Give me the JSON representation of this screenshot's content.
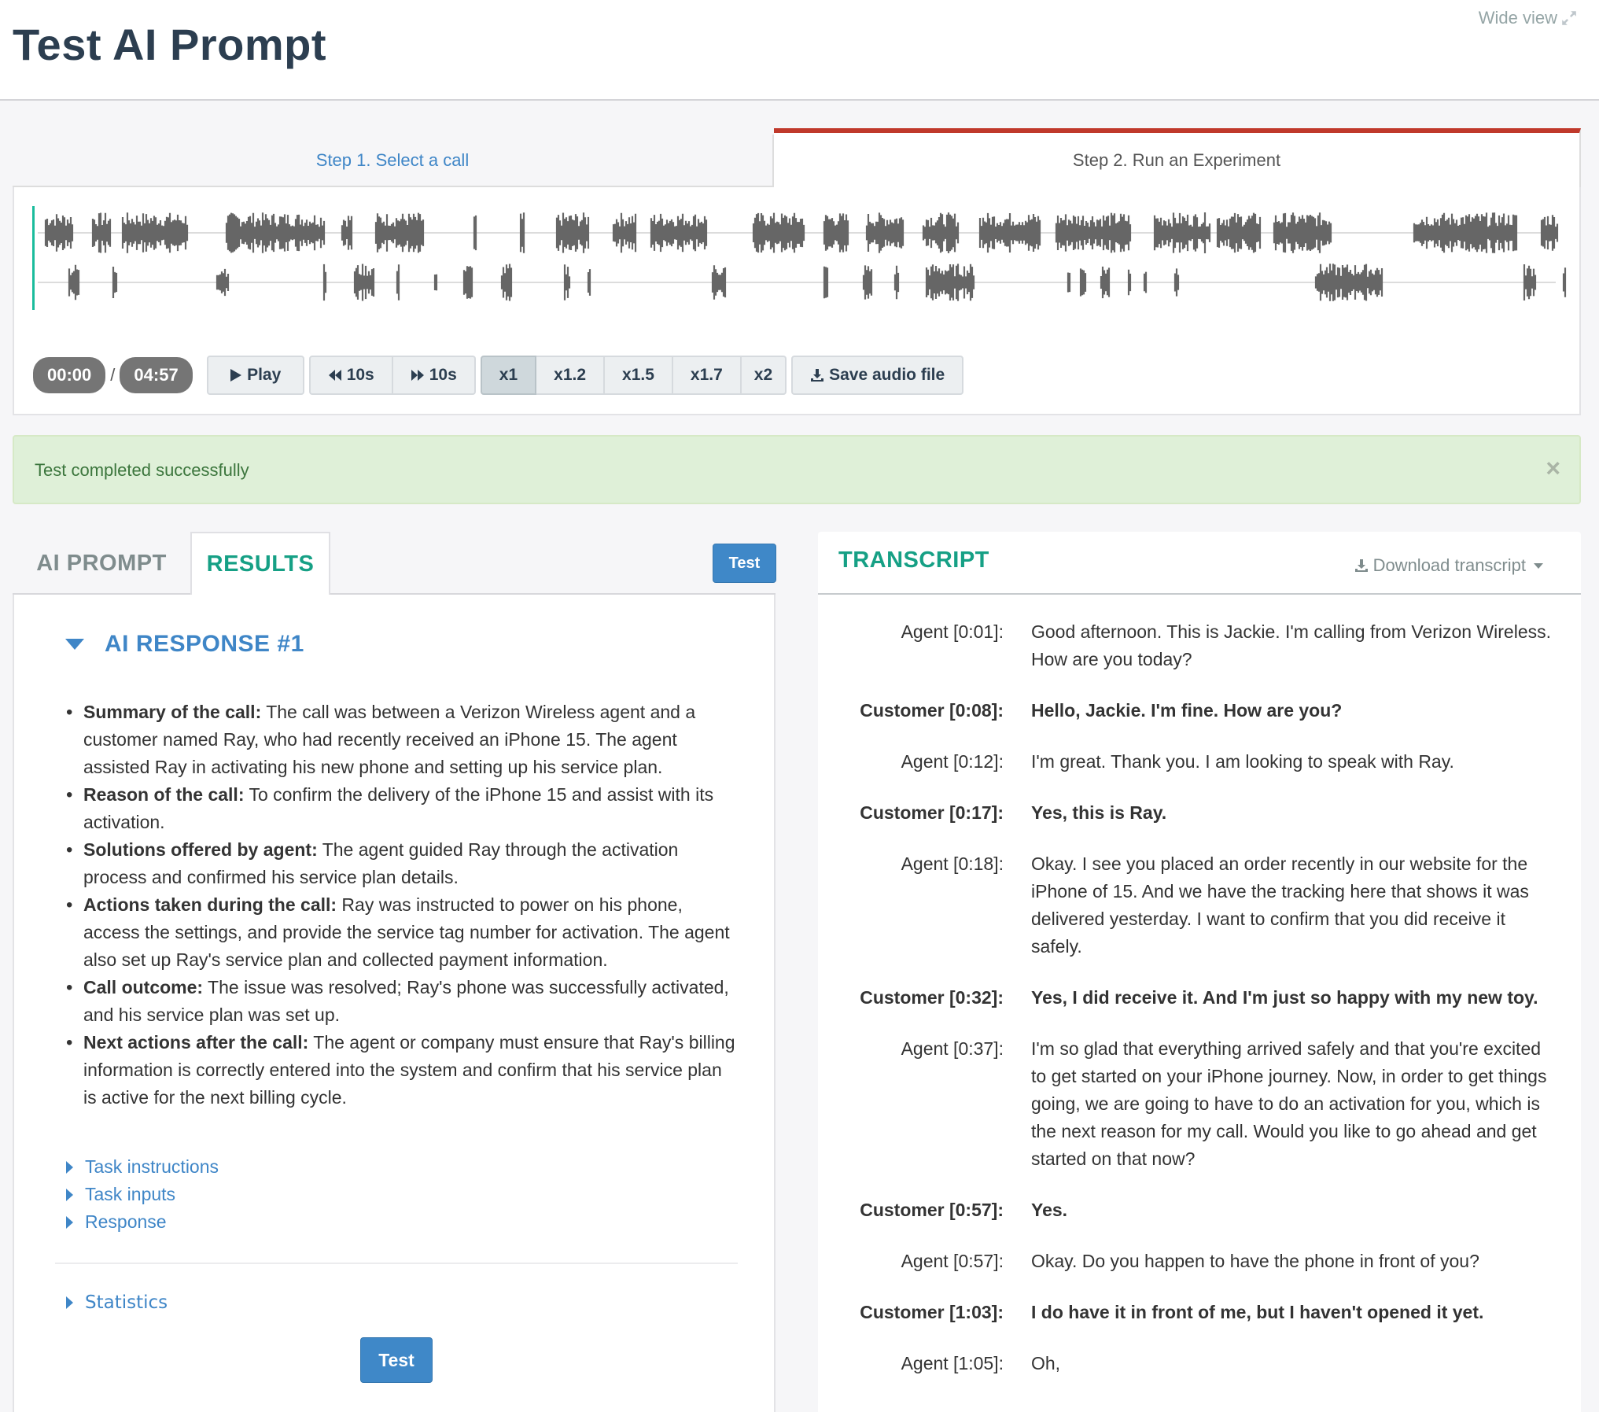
{
  "header": {
    "title": "Test AI Prompt",
    "wide_view_label": "Wide view"
  },
  "steps": [
    {
      "label": "Step 1. Select a call",
      "active": false
    },
    {
      "label": "Step 2. Run an Experiment",
      "active": true
    }
  ],
  "player": {
    "current_time": "00:00",
    "separator": "/",
    "total_time": "04:57",
    "play_label": "Play",
    "rewind_label": "10s",
    "forward_label": "10s",
    "speeds": [
      "x1",
      "x1.2",
      "x1.5",
      "x1.7",
      "x2"
    ],
    "active_speed": "x1",
    "save_label": "Save audio file",
    "progress": 0
  },
  "alert": {
    "message": "Test completed successfully",
    "close_symbol": "×"
  },
  "left_tabs": {
    "prompt_label": "AI PROMPT",
    "results_label": "RESULTS",
    "active": "RESULTS",
    "test_label": "Test"
  },
  "results": {
    "response_title": "AI RESPONSE #1",
    "summary": [
      {
        "label": "Summary of the call:",
        "text": " The call was between a Verizon Wireless agent and a customer named Ray, who had recently received an iPhone 15. The agent assisted Ray in activating his new phone and setting up his service plan."
      },
      {
        "label": "Reason of the call:",
        "text": " To confirm the delivery of the iPhone 15 and assist with its activation."
      },
      {
        "label": "Solutions offered by agent:",
        "text": " The agent guided Ray through the activation process and confirmed his service plan details."
      },
      {
        "label": "Actions taken during the call:",
        "text": " Ray was instructed to power on his phone, access the settings, and provide the service tag number for activation. The agent also set up Ray's service plan and collected payment information."
      },
      {
        "label": "Call outcome:",
        "text": " The issue was resolved; Ray's phone was successfully activated, and his service plan was set up."
      },
      {
        "label": "Next actions after the call:",
        "text": " The agent or company must ensure that Ray's billing information is correctly entered into the system and confirm that his service plan is active for the next billing cycle."
      }
    ],
    "links": [
      "Task instructions",
      "Task inputs",
      "Response"
    ],
    "statistics_label": "Statistics",
    "test_label": "Test"
  },
  "transcript": {
    "title": "TRANSCRIPT",
    "download_label": "Download transcript",
    "rows": [
      {
        "speaker": "Agent [0:01]:",
        "role": "agent",
        "text": "Good afternoon. This is Jackie. I'm calling from Verizon Wireless. How are you today?"
      },
      {
        "speaker": "Customer [0:08]:",
        "role": "customer",
        "text": "Hello, Jackie. I'm fine. How are you?"
      },
      {
        "speaker": "Agent [0:12]:",
        "role": "agent",
        "text": "I'm great. Thank you. I am looking to speak with Ray."
      },
      {
        "speaker": "Customer [0:17]:",
        "role": "customer",
        "text": "Yes, this is Ray."
      },
      {
        "speaker": "Agent [0:18]:",
        "role": "agent",
        "text": "Okay. I see you placed an order recently in our website for the iPhone of 15. And we have the tracking here that shows it was delivered yesterday. I want to confirm that you did receive it safely."
      },
      {
        "speaker": "Customer [0:32]:",
        "role": "customer",
        "text": "Yes, I did receive it. And I'm just so happy with my new toy."
      },
      {
        "speaker": "Agent [0:37]:",
        "role": "agent",
        "text": "I'm so glad that everything arrived safely and that you're excited to get started on your iPhone journey. Now, in order to get things going, we are going to have to do an activation for you, which is the next reason for my call. Would you like to go ahead and get started on that now?"
      },
      {
        "speaker": "Customer [0:57]:",
        "role": "customer",
        "text": "Yes."
      },
      {
        "speaker": "Agent [0:57]:",
        "role": "agent",
        "text": "Okay. Do you happen to have the phone in front of you?"
      },
      {
        "speaker": "Customer [1:03]:",
        "role": "customer",
        "text": "I do have it in front of me, but I haven't opened it yet."
      },
      {
        "speaker": "Agent [1:05]:",
        "role": "agent",
        "text": "Oh,"
      }
    ]
  },
  "colors": {
    "accent_blue": "#3f86c7",
    "accent_green": "#16a085",
    "active_step_bar": "#c0392b",
    "cursor": "#1abc9c",
    "waveform": "#666666",
    "alert_bg": "#dff0d8",
    "alert_text": "#3c763d"
  }
}
